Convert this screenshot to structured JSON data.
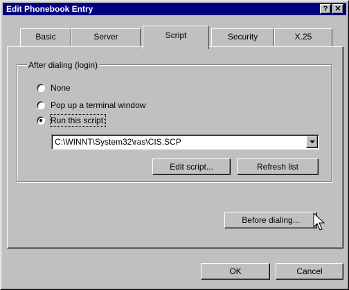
{
  "window": {
    "title": "Edit Phonebook Entry",
    "help_button": "?",
    "close_button": "✕"
  },
  "tabs": [
    {
      "label": "Basic",
      "active": false
    },
    {
      "label": "Server",
      "active": false
    },
    {
      "label": "Script",
      "active": true
    },
    {
      "label": "Security",
      "active": false
    },
    {
      "label": "X.25",
      "active": false
    }
  ],
  "group": {
    "label": "After dialing (login)",
    "options": [
      {
        "label": "None",
        "checked": false
      },
      {
        "label": "Pop up a terminal window",
        "checked": false
      },
      {
        "label": "Run this script:",
        "checked": true
      }
    ],
    "script_path": "C:\\WINNT\\System32\\ras\\CIS.SCP",
    "edit_script_label": "Edit script...",
    "refresh_list_label": "Refresh list"
  },
  "before_dialing_label": "Before dialing...",
  "footer": {
    "ok_label": "OK",
    "cancel_label": "Cancel"
  },
  "colors": {
    "title_bar": "#000080",
    "face": "#c0c0c0"
  }
}
